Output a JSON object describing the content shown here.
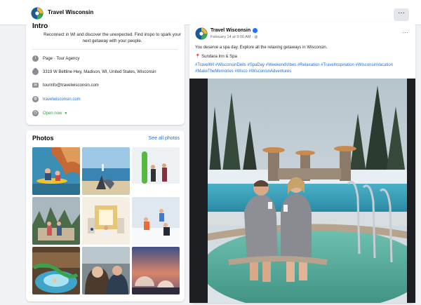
{
  "header": {
    "page_name": "Travel Wisconsin",
    "more_label": "···"
  },
  "intro": {
    "title": "Intro",
    "description": "Reconnect in WI and discover the unexpected. Find inspo to spark your next getaway with your people.",
    "page_type_prefix": "Page",
    "page_type": "Tour Agency",
    "address": "3319 W Beltline Hwy, Madison, WI, United States, Wisconsin",
    "email": "tourinfo@travelwisconsin.com",
    "website": "travelwisconsin.com",
    "hours": "Open now"
  },
  "photos": {
    "title": "Photos",
    "see_all": "See all photos",
    "items": [
      {
        "label": "kayaking-rocks"
      },
      {
        "label": "lighthouse-beach"
      },
      {
        "label": "skiing-couple"
      },
      {
        "label": "cabin-couple"
      },
      {
        "label": "ice-castle"
      },
      {
        "label": "snowboarding-kids"
      },
      {
        "label": "waterpark-slide"
      },
      {
        "label": "winter-selfie"
      },
      {
        "label": "igloo-sunset"
      }
    ]
  },
  "post": {
    "author": "Travel Wisconsin",
    "date": "February 14 at 9:00 AM · ",
    "menu": "···",
    "text": "You deserve a spa day. Explore all the relaxing getaways in Wisconsin.",
    "location": "Sundara Inn & Spa",
    "hashtags": "#TravelWI #WisconsinDells #SpaDay #WeekendVibes #Relaxation #TravelInspiration #WisconsinVacation #MakeTheMemories #Wsco #WisconsinAdventures"
  },
  "colors": {
    "link": "#216fdb",
    "open": "#31a24c",
    "background": "#f0f2f5"
  }
}
